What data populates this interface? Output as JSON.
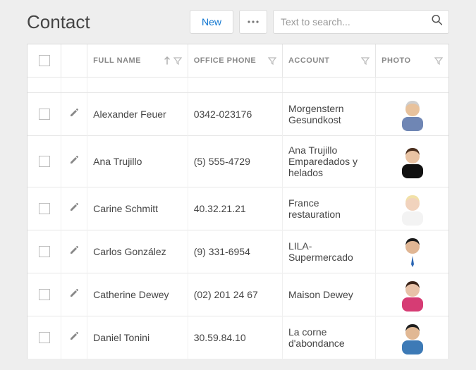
{
  "header": {
    "title": "Contact",
    "new_label": "New",
    "search_placeholder": "Text to search..."
  },
  "columns": {
    "full_name": "FULL NAME",
    "office_phone": "OFFICE PHONE",
    "account": "ACCOUNT",
    "photo": "PHOTO"
  },
  "rows": [
    {
      "full_name": "Alexander Feuer",
      "office_phone": "0342-023176",
      "account": "Morgenstern Gesundkost",
      "avatar": {
        "shirt": "#6f86b4",
        "skin": "#e8c29c",
        "hair": "#cfcfcf"
      }
    },
    {
      "full_name": "Ana Trujillo",
      "office_phone": "(5) 555-4729",
      "account": "Ana Trujillo Emparedados y helados",
      "avatar": {
        "shirt": "#111111",
        "skin": "#e9c3a3",
        "hair": "#4b2f1e"
      }
    },
    {
      "full_name": "Carine Schmitt",
      "office_phone": "40.32.21.21",
      "account": "France restauration",
      "avatar": {
        "shirt": "#f3f3f3",
        "skin": "#f1d3bd",
        "hair": "#f2e1a8"
      }
    },
    {
      "full_name": "Carlos González",
      "office_phone": "(9) 331-6954",
      "account": "LILA-Supermercado",
      "avatar": {
        "shirt": "#ffffff",
        "skin": "#e0b694",
        "hair": "#1a1a1a",
        "tie": "#2b66b3"
      }
    },
    {
      "full_name": "Catherine Dewey",
      "office_phone": "(02) 201 24 67",
      "account": "Maison Dewey",
      "avatar": {
        "shirt": "#d63c74",
        "skin": "#e8c2a8",
        "hair": "#3b2419"
      }
    },
    {
      "full_name": "Daniel Tonini",
      "office_phone": "30.59.84.10",
      "account": "La corne d'abondance",
      "avatar": {
        "shirt": "#3d7ab6",
        "skin": "#e1b894",
        "hair": "#1e1e1e"
      }
    }
  ]
}
